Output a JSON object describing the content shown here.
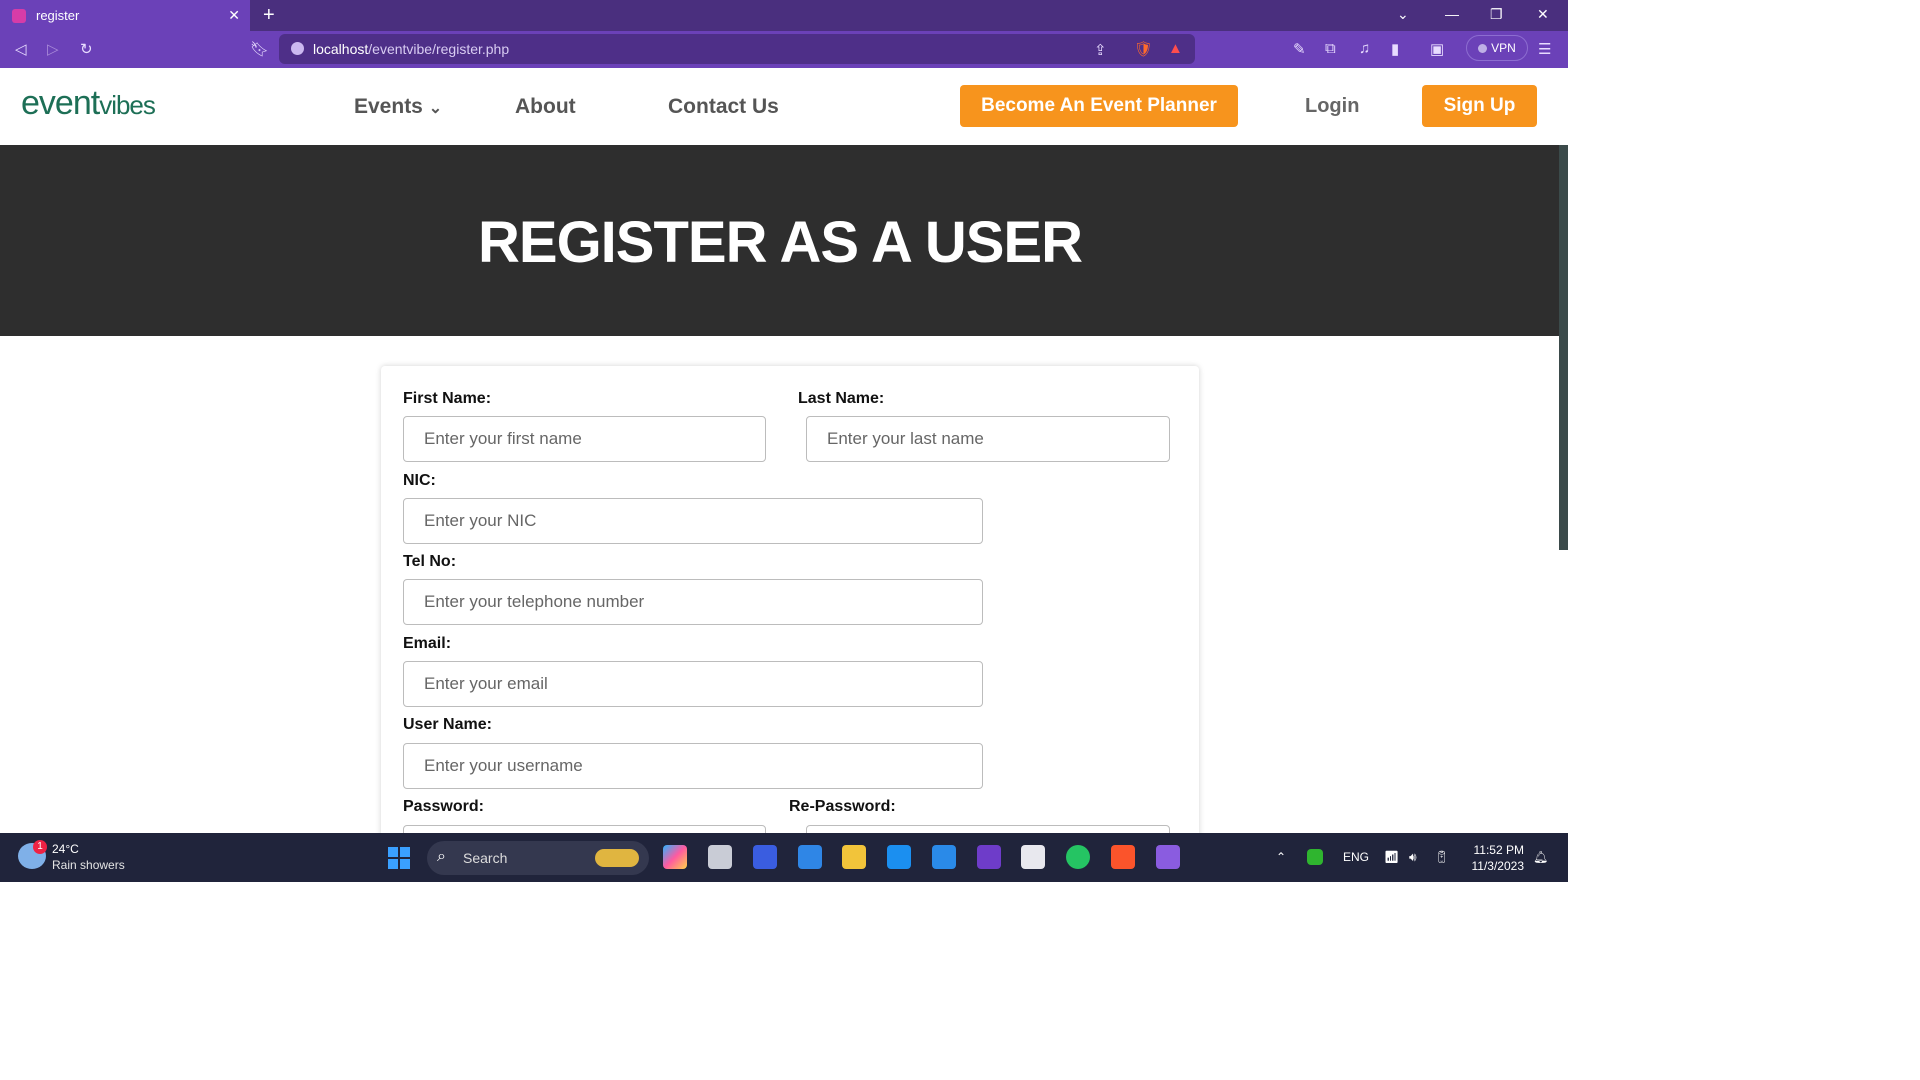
{
  "browser": {
    "tab_title": "register",
    "tab_close": "✕",
    "new_tab": "+",
    "url_host": "localhost",
    "url_path": "/eventvibe/register.php",
    "vpn_label": "VPN",
    "icons": [
      "back-icon",
      "forward-icon",
      "reload-icon",
      "bookmark-icon",
      "share-icon",
      "brave-shields-icon",
      "brave-rewards-icon",
      "pen-icon",
      "extensions-icon",
      "music-icon",
      "sidebar-icon",
      "wallet-icon",
      "menu-icon"
    ]
  },
  "site": {
    "logo_main": "event",
    "logo_small": "vibes",
    "nav": {
      "events": "Events",
      "events_caret": "⌄",
      "about": "About",
      "contact": "Contact Us",
      "planner": "Become An Event Planner",
      "login": "Login",
      "signup": "Sign Up"
    },
    "colors": {
      "accent": "#f7941d",
      "hero_bg": "#2e2e2e",
      "logo": "#1d6f56",
      "browser": "#6b41b8"
    }
  },
  "hero": {
    "title": "REGISTER AS A USER"
  },
  "form": {
    "first_name": {
      "label": "First Name:",
      "placeholder": "Enter your first name"
    },
    "last_name": {
      "label": "Last Name:",
      "placeholder": "Enter your last name"
    },
    "nic": {
      "label": "NIC:",
      "placeholder": "Enter your NIC"
    },
    "tel": {
      "label": "Tel No:",
      "placeholder": "Enter your telephone number"
    },
    "email": {
      "label": "Email:",
      "placeholder": "Enter your email"
    },
    "username": {
      "label": "User Name:",
      "placeholder": "Enter your username"
    },
    "password": {
      "label": "Password:"
    },
    "repassword": {
      "label": "Re-Password:"
    }
  },
  "taskbar": {
    "weather_badge": "1",
    "temperature": "24°C",
    "condition": "Rain showers",
    "search_label": "Search",
    "language": "ENG",
    "time": "11:52 PM",
    "date": "11/3/2023"
  }
}
